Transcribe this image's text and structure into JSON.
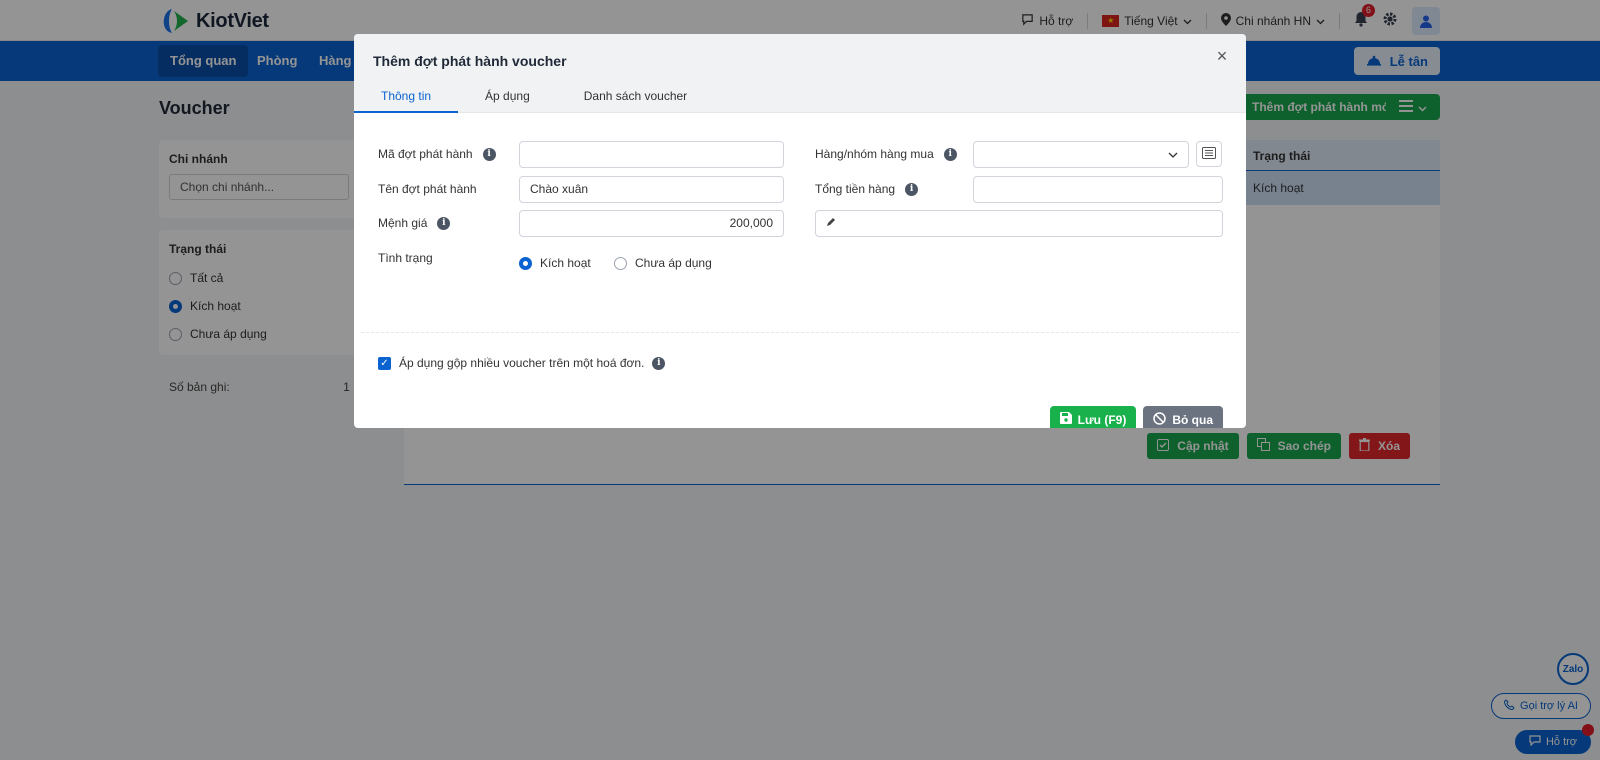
{
  "header": {
    "brand": "KiotViet",
    "support": "Hỗ trợ",
    "language": "Tiếng Việt",
    "branch": "Chi nhánh HN",
    "notification_count": "6"
  },
  "nav": {
    "items": [
      {
        "label": "Tổng quan"
      },
      {
        "label": "Phòng"
      },
      {
        "label": "Hàng h"
      }
    ],
    "reception_button": "Lễ tân"
  },
  "page": {
    "title": "Voucher",
    "branch_filter": {
      "title": "Chi nhánh",
      "placeholder": "Chọn chi nhánh..."
    },
    "status_filter": {
      "title": "Trạng thái",
      "options": [
        {
          "label": "Tất cả",
          "selected": false
        },
        {
          "label": "Kích hoạt",
          "selected": true
        },
        {
          "label": "Chưa áp dụng",
          "selected": false
        }
      ]
    },
    "records_label": "Số bản ghi:",
    "records_value": "1",
    "add_button": "Thêm đợt phát hành mới",
    "table": {
      "status_header": "Trạng thái",
      "row_status": "Kích hoạt"
    },
    "detail_actions": {
      "update": "Cập nhật",
      "copy": "Sao chép",
      "delete": "Xóa"
    }
  },
  "floating": {
    "zalo": "Zalo",
    "ai_assistant": "Gọi trợ lý AI",
    "help": "Hỗ trợ"
  },
  "modal": {
    "title": "Thêm đợt phát hành voucher",
    "tabs": [
      {
        "label": "Thông tin",
        "active": true
      },
      {
        "label": "Áp dụng",
        "active": false
      },
      {
        "label": "Danh sách voucher",
        "active": false
      }
    ],
    "fields": {
      "code": {
        "label": "Mã đợt phát hành",
        "value": ""
      },
      "name": {
        "label": "Tên đợt phát hành",
        "value": "Chào xuân"
      },
      "denomination": {
        "label": "Mệnh giá",
        "value": "200,000"
      },
      "status": {
        "label": "Tình trạng",
        "options": [
          {
            "label": "Kích hoạt",
            "selected": true
          },
          {
            "label": "Chưa áp dụng",
            "selected": false
          }
        ]
      },
      "goods_group": {
        "label": "Hàng/nhóm hàng mua",
        "value": ""
      },
      "total_amount": {
        "label": "Tổng tiền hàng",
        "value": ""
      },
      "note": {
        "value": ""
      }
    },
    "combine_checkbox": {
      "label": "Áp dụng gộp nhiều voucher trên một hoá đơn.",
      "checked": true
    },
    "buttons": {
      "save": "Lưu (F9)",
      "skip": "Bỏ qua"
    }
  }
}
